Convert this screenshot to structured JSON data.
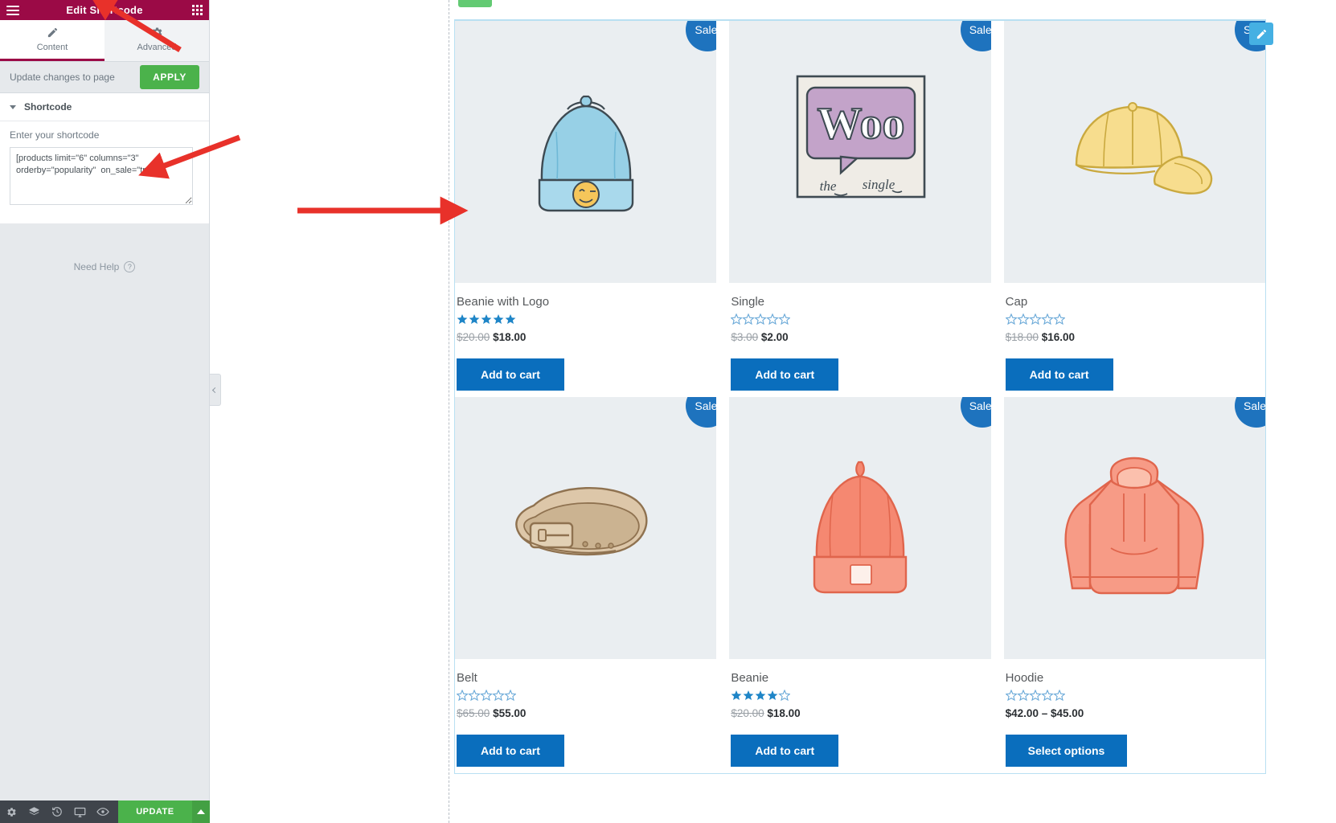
{
  "panel": {
    "header": {
      "title": "Edit Shortcode",
      "menu_icon": "hamburger-icon",
      "apps_icon": "grid-icon"
    },
    "tabs": [
      {
        "label": "Content",
        "icon": "pencil-icon",
        "active": true
      },
      {
        "label": "Advanced",
        "icon": "gear-icon",
        "active": false
      }
    ],
    "apply_row": {
      "label": "Update changes to page",
      "button": "APPLY"
    },
    "section": {
      "title": "Shortcode",
      "field_label": "Enter your shortcode",
      "field_value": "[products limit=\"6\" columns=\"3\" orderby=\"popularity\"  on_sale=\"true\" ]",
      "field_placeholder": "Enter your shortcode"
    },
    "need_help": {
      "label": "Need Help",
      "icon": "question-mark-icon"
    },
    "footer": {
      "icons": [
        "gear-icon",
        "layers-icon",
        "history-icon",
        "responsive-mode-icon",
        "preview-eye-icon"
      ],
      "update_button": "UPDATE",
      "update_caret_icon": "caret-up-icon"
    },
    "collapse_handle_icon": "chevron-left-icon"
  },
  "canvas": {
    "edit_section_icon": "pencil-edit-icon",
    "sale_badge_label": "Sale!",
    "products": [
      {
        "name": "Beanie with Logo",
        "illustration": "blue-beanie-with-smiley-logo",
        "rating": 5,
        "old_price": "$20.00",
        "new_price": "$18.00",
        "price_range": "",
        "button": "Add to cart",
        "on_sale": true
      },
      {
        "name": "Single",
        "illustration": "woo-the-single-album-cover",
        "rating": 0,
        "old_price": "$3.00",
        "new_price": "$2.00",
        "price_range": "",
        "button": "Add to cart",
        "on_sale": true
      },
      {
        "name": "Cap",
        "illustration": "yellow-baseball-cap",
        "rating": 0,
        "old_price": "$18.00",
        "new_price": "$16.00",
        "price_range": "",
        "button": "Add to cart",
        "on_sale": true
      },
      {
        "name": "Belt",
        "illustration": "brown-leather-belt",
        "rating": 0,
        "old_price": "$65.00",
        "new_price": "$55.00",
        "price_range": "",
        "button": "Add to cart",
        "on_sale": true
      },
      {
        "name": "Beanie",
        "illustration": "red-beanie",
        "rating": 4,
        "old_price": "$20.00",
        "new_price": "$18.00",
        "price_range": "",
        "button": "Add to cart",
        "on_sale": true
      },
      {
        "name": "Hoodie",
        "illustration": "pink-hoodie",
        "rating": 0,
        "old_price": "",
        "new_price": "",
        "price_range": "$42.00 – $45.00",
        "button": "Select options",
        "on_sale": true
      }
    ]
  },
  "colors": {
    "panel_header": "#9b0a46",
    "apply_green": "#4bb24b",
    "sale_blue": "#1e73be",
    "cart_blue": "#0a6ebd",
    "star_blue": "#1e85c7",
    "annotation_red": "#e8312a",
    "section_outline": "#b9e0f2"
  }
}
